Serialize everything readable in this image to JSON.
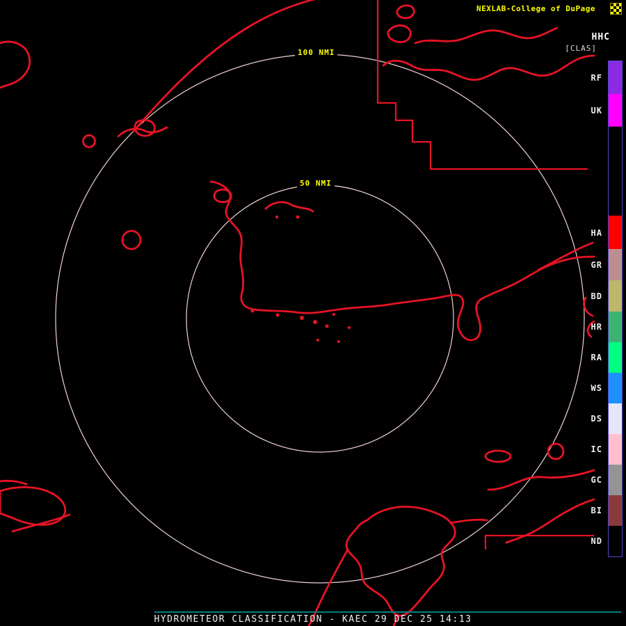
{
  "header": {
    "brand": "NEXLAB-College of DuPage",
    "product_code": "HHC",
    "classification": "[CLAS]"
  },
  "map": {
    "outer_ring_label": "100 NMI",
    "inner_ring_label": "50 NMI"
  },
  "legend": {
    "items": [
      {
        "label": "RF",
        "color": "#8a2be2"
      },
      {
        "label": "UK",
        "color": "#ff00ff"
      },
      {
        "label": "HA",
        "color": "#ff0000"
      },
      {
        "label": "GR",
        "color": "#bc8f8f"
      },
      {
        "label": "BD",
        "color": "#bdb76b"
      },
      {
        "label": "HR",
        "color": "#3cb371"
      },
      {
        "label": "RA",
        "color": "#00ff7f"
      },
      {
        "label": "WS",
        "color": "#1e90ff"
      },
      {
        "label": "DS",
        "color": "#e6e6fa"
      },
      {
        "label": "IC",
        "color": "#ffc0cb"
      },
      {
        "label": "GC",
        "color": "#949494"
      },
      {
        "label": "BI",
        "color": "#8b3a3a"
      },
      {
        "label": "ND",
        "color": "#000000"
      }
    ]
  },
  "statusbar": {
    "text": "HYDROMETEOR CLASSIFICATION - KAEC 29 DEC 25 14:13"
  },
  "colors": {
    "background": "#000000",
    "map_outline": "#e81325",
    "range_ring": "#f3d3d3",
    "ring_label": "#ffff00",
    "brand_text": "#ffff00",
    "product_text": "#ffffff",
    "legend_border": "#5544cc",
    "status_rule": "#008080",
    "status_text": "#f0f0f0",
    "legend_label": "#f0f0f0"
  }
}
